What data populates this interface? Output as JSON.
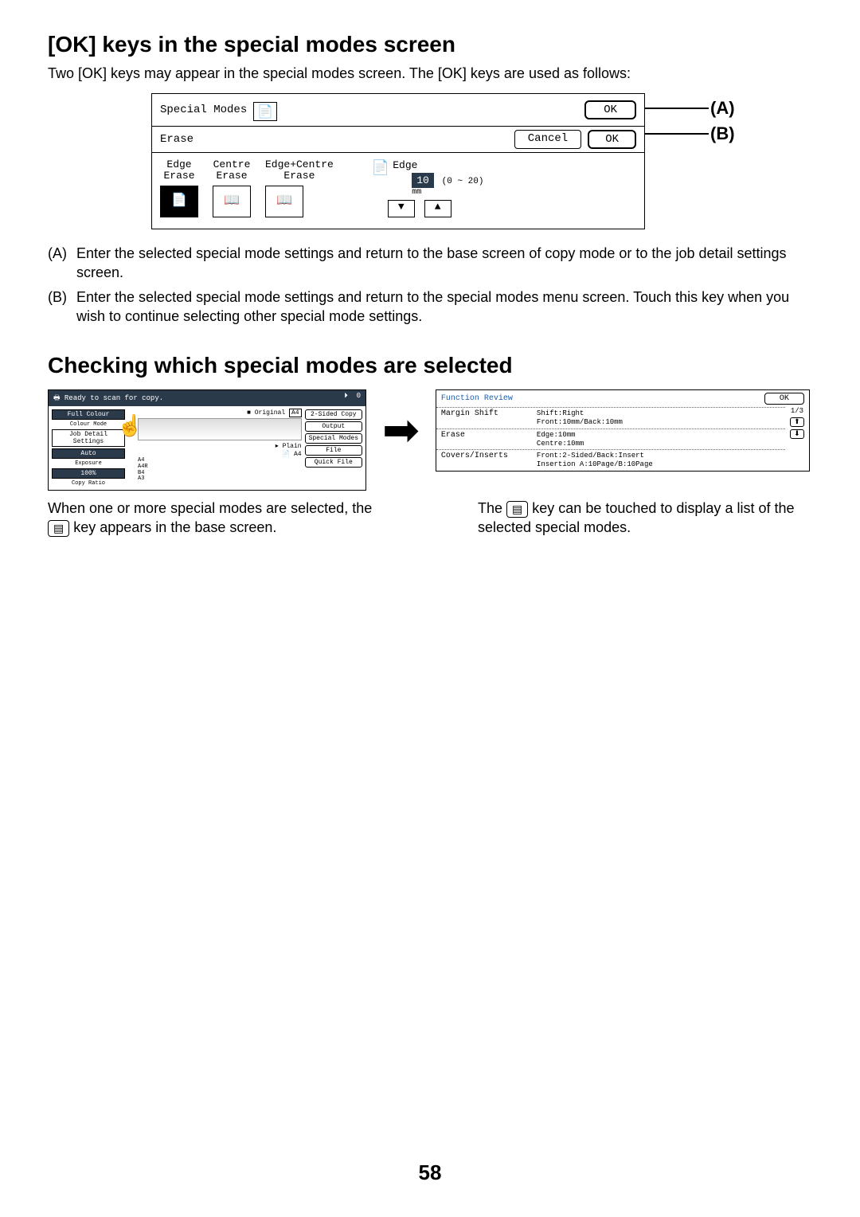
{
  "section1": {
    "heading": "[OK] keys in the special modes screen",
    "intro": "Two [OK] keys may appear in the special modes screen. The [OK] keys are used as follows:",
    "panel": {
      "title": "Special Modes",
      "ok_a": "OK",
      "erase_label": "Erase",
      "cancel": "Cancel",
      "ok_b": "OK",
      "modes": {
        "edge": "Edge\nErase",
        "centre": "Centre\nErase",
        "edgecentre": "Edge+Centre\nErase"
      },
      "edge_control": {
        "label": "Edge",
        "value": "10",
        "range": "(0 ~ 20)",
        "unit": "mm",
        "down": "▼",
        "up": "▲"
      }
    },
    "callout_a": "(A)",
    "callout_b": "(B)",
    "para_a_tag": "(A)",
    "para_a_text": "Enter the selected special mode settings and return to the base screen of copy mode or to the job detail settings screen.",
    "para_b_tag": "(B)",
    "para_b_text": "Enter the selected special mode settings and return to the special modes menu screen. Touch this key when you wish to continue selecting other special mode settings."
  },
  "section2": {
    "heading": "Checking which special modes are selected",
    "left_panel": {
      "status": "Ready to scan for copy.",
      "count": "0",
      "col1": {
        "full_colour": "Full Colour",
        "colour_mode_sub": "Colour Mode",
        "job_detail": "Job Detail\nSettings",
        "auto": "Auto",
        "exposure_sub": "Exposure",
        "zoom": "100%",
        "copy_ratio_sub": "Copy Ratio"
      },
      "mid": {
        "original": "Original",
        "a4": "A4",
        "plain": "Plain",
        "tray_a4": "A4",
        "trays": "A4\nA4R\nB4\nA3"
      },
      "right_buttons": [
        "2-Sided Copy",
        "Output",
        "Special Modes",
        "File",
        "Quick File"
      ]
    },
    "right_panel": {
      "title": "Function Review",
      "ok": "OK",
      "page": "1/3",
      "up": "⬆",
      "down": "⬇",
      "rows": [
        {
          "label": "Margin Shift",
          "detail": "Shift:Right\nFront:10mm/Back:10mm"
        },
        {
          "label": "Erase",
          "detail": "Edge:10mm\nCentre:10mm"
        },
        {
          "label": "Covers/Inserts",
          "detail": "Front:2-Sided/Back:Insert\nInsertion A:10Page/B:10Page"
        }
      ]
    },
    "caption_left_pre": "When one or more special modes are selected, the ",
    "caption_left_post": " key appears in the base screen.",
    "caption_right_pre": "The ",
    "caption_right_post": " key can be touched to display a list of the selected special modes.",
    "icon_glyph": "▤"
  },
  "page_number": "58"
}
